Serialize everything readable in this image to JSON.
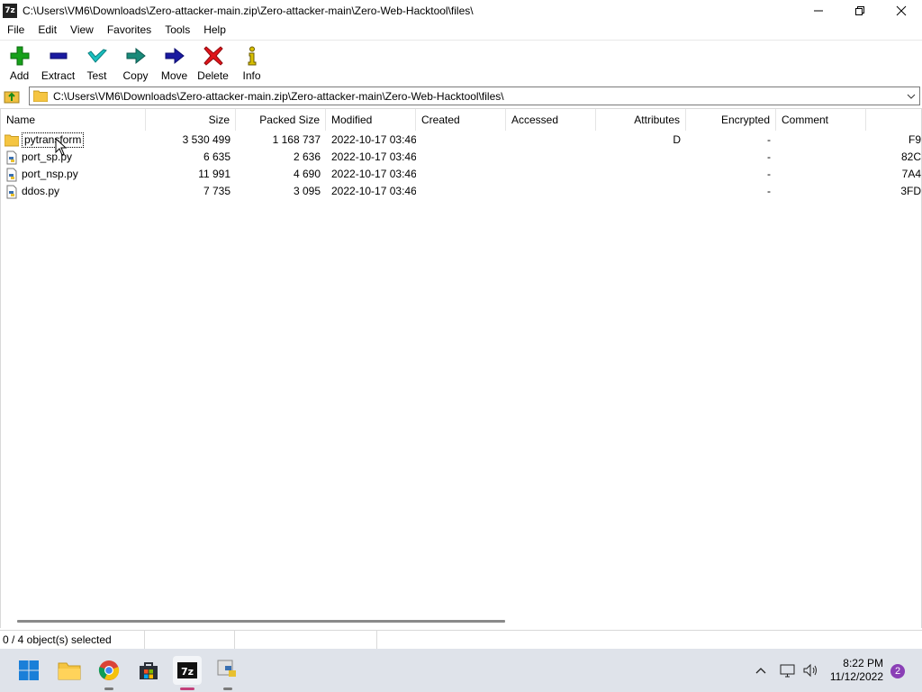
{
  "window": {
    "title": "C:\\Users\\VM6\\Downloads\\Zero-attacker-main.zip\\Zero-attacker-main\\Zero-Web-Hacktool\\files\\",
    "app_icon": "7z"
  },
  "menu": [
    "File",
    "Edit",
    "View",
    "Favorites",
    "Tools",
    "Help"
  ],
  "toolbar": [
    {
      "label": "Add",
      "icon": "plus-icon",
      "color": "#16a01a"
    },
    {
      "label": "Extract",
      "icon": "minus-icon",
      "color": "#1a1aa0"
    },
    {
      "label": "Test",
      "icon": "check-icon",
      "color": "#1ab8b8"
    },
    {
      "label": "Copy",
      "icon": "arrow-right-icon",
      "color": "#1a8a8a"
    },
    {
      "label": "Move",
      "icon": "arrow-right-icon",
      "color": "#1a1aa0"
    },
    {
      "label": "Delete",
      "icon": "x-icon",
      "color": "#e0141a"
    },
    {
      "label": "Info",
      "icon": "info-icon",
      "color": "#c8b000"
    }
  ],
  "address": {
    "path": "C:\\Users\\VM6\\Downloads\\Zero-attacker-main.zip\\Zero-attacker-main\\Zero-Web-Hacktool\\files\\"
  },
  "columns": [
    "Name",
    "Size",
    "Packed Size",
    "Modified",
    "Created",
    "Accessed",
    "Attributes",
    "Encrypted",
    "Comment",
    ""
  ],
  "files": [
    {
      "name": "pytransform",
      "type": "folder",
      "size": "3 530 499",
      "packed": "1 168 737",
      "modified": "2022-10-17 03:46",
      "created": "",
      "accessed": "",
      "attributes": "D",
      "encrypted": "-",
      "comment": "",
      "crc": "F9"
    },
    {
      "name": "port_sp.py",
      "type": "file",
      "size": "6 635",
      "packed": "2 636",
      "modified": "2022-10-17 03:46",
      "created": "",
      "accessed": "",
      "attributes": "",
      "encrypted": "-",
      "comment": "",
      "crc": "82C"
    },
    {
      "name": "port_nsp.py",
      "type": "file",
      "size": "11 991",
      "packed": "4 690",
      "modified": "2022-10-17 03:46",
      "created": "",
      "accessed": "",
      "attributes": "",
      "encrypted": "-",
      "comment": "",
      "crc": "7A4"
    },
    {
      "name": "ddos.py",
      "type": "file",
      "size": "7 735",
      "packed": "3 095",
      "modified": "2022-10-17 03:46",
      "created": "",
      "accessed": "",
      "attributes": "",
      "encrypted": "-",
      "comment": "",
      "crc": "3FD"
    }
  ],
  "status": {
    "selection": "0 / 4 object(s) selected",
    "second": "",
    "third": ""
  },
  "taskbar": {
    "apps": [
      "start-icon",
      "file-explorer-icon",
      "chrome-icon",
      "store-icon",
      "7zip-icon",
      "python-icon"
    ],
    "time": "8:22 PM",
    "date": "11/12/2022",
    "notifications": "2"
  }
}
